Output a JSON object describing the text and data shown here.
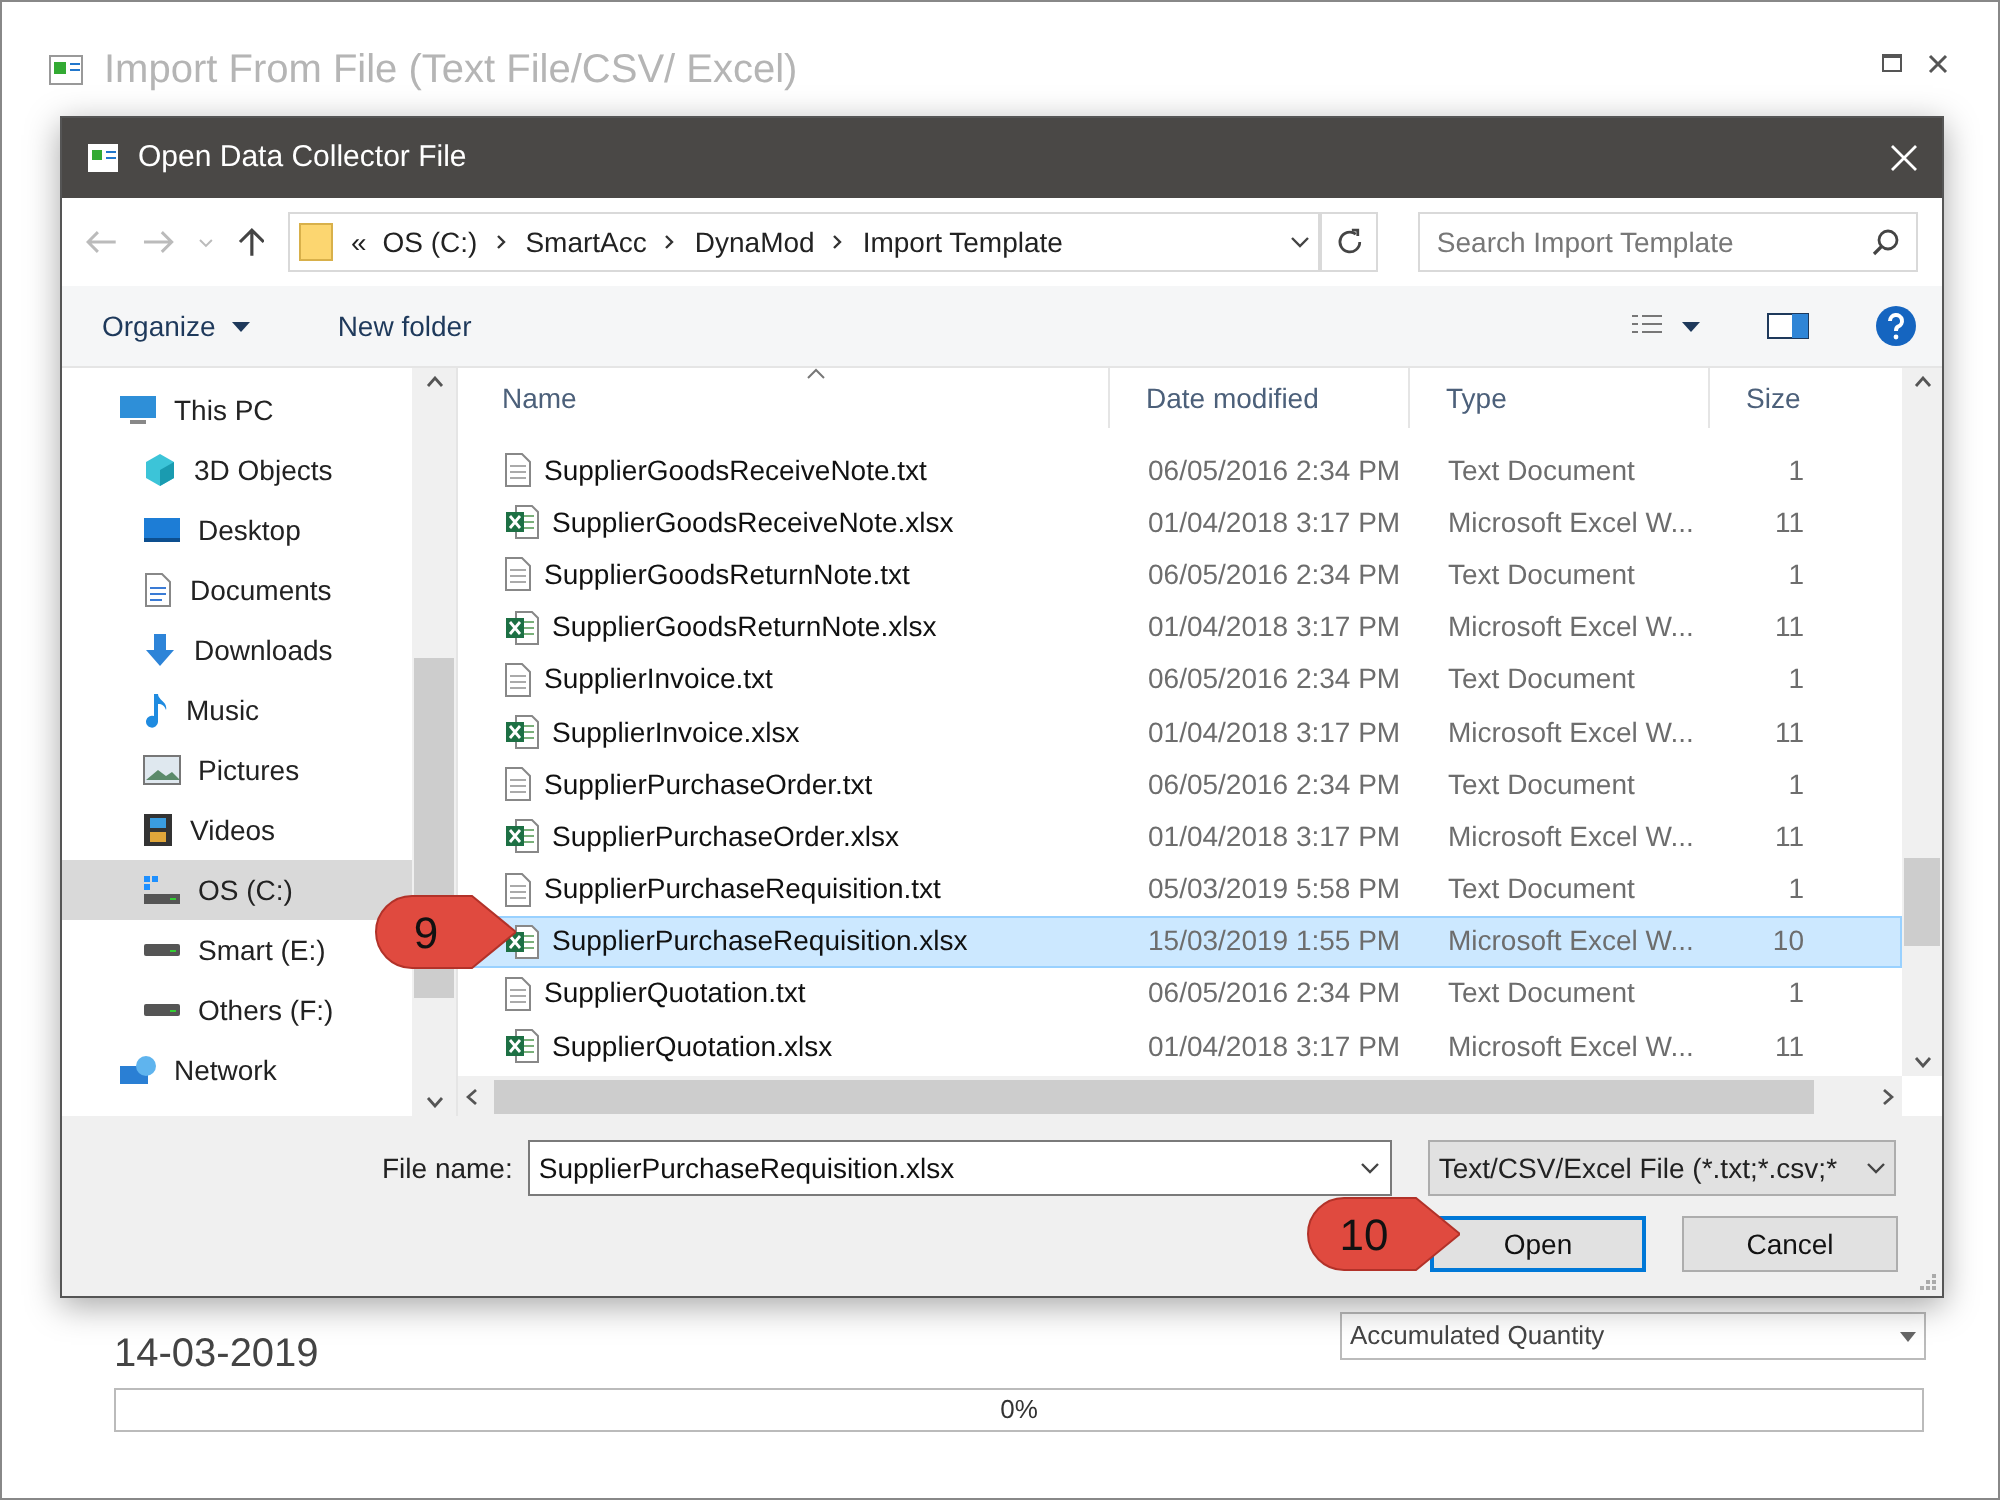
{
  "background_window": {
    "title": "Import From File (Text File/CSV/ Excel)",
    "date": "14-03-2019",
    "mode_dropdown": "Accumulated Quantity",
    "progress": {
      "level": 0,
      "reading": "0%"
    }
  },
  "dialog": {
    "title": "Open Data Collector File",
    "address": {
      "prefix": "«",
      "crumbs": [
        "OS (C:)",
        "SmartAcc",
        "DynaMod",
        "Import Template"
      ]
    },
    "search": {
      "placeholder": "Search Import Template"
    },
    "toolbar": {
      "organize": "Organize",
      "new_folder": "New folder"
    },
    "nav": [
      {
        "label": "This PC",
        "kind": "pc",
        "selected": false,
        "children": [
          {
            "label": "3D Objects",
            "kind": "cube",
            "selected": false
          },
          {
            "label": "Desktop",
            "kind": "desktop",
            "selected": false
          },
          {
            "label": "Documents",
            "kind": "documents",
            "selected": false
          },
          {
            "label": "Downloads",
            "kind": "download",
            "selected": false
          },
          {
            "label": "Music",
            "kind": "music",
            "selected": false
          },
          {
            "label": "Pictures",
            "kind": "pictures",
            "selected": false
          },
          {
            "label": "Videos",
            "kind": "videos",
            "selected": false
          },
          {
            "label": "OS (C:)",
            "kind": "drive-os",
            "selected": true
          },
          {
            "label": "Smart (E:)",
            "kind": "drive",
            "selected": false
          },
          {
            "label": "Others (F:)",
            "kind": "drive",
            "selected": false
          }
        ]
      },
      {
        "label": "Network",
        "kind": "network",
        "selected": false
      }
    ],
    "columns": [
      "Name",
      "Date modified",
      "Type",
      "Size"
    ],
    "files": [
      {
        "kind": "txt",
        "name": "SupplierGoodsReceiveNote.txt",
        "date": "06/05/2016 2:34 PM",
        "type": "Text Document",
        "size": "1",
        "selected": false
      },
      {
        "kind": "xlsx",
        "name": "SupplierGoodsReceiveNote.xlsx",
        "date": "01/04/2018 3:17 PM",
        "type": "Microsoft Excel W...",
        "size": "11",
        "selected": false
      },
      {
        "kind": "txt",
        "name": "SupplierGoodsReturnNote.txt",
        "date": "06/05/2016 2:34 PM",
        "type": "Text Document",
        "size": "1",
        "selected": false
      },
      {
        "kind": "xlsx",
        "name": "SupplierGoodsReturnNote.xlsx",
        "date": "01/04/2018 3:17 PM",
        "type": "Microsoft Excel W...",
        "size": "11",
        "selected": false
      },
      {
        "kind": "txt",
        "name": "SupplierInvoice.txt",
        "date": "06/05/2016 2:34 PM",
        "type": "Text Document",
        "size": "1",
        "selected": false
      },
      {
        "kind": "xlsx",
        "name": "SupplierInvoice.xlsx",
        "date": "01/04/2018 3:17 PM",
        "type": "Microsoft Excel W...",
        "size": "11",
        "selected": false
      },
      {
        "kind": "txt",
        "name": "SupplierPurchaseOrder.txt",
        "date": "06/05/2016 2:34 PM",
        "type": "Text Document",
        "size": "1",
        "selected": false
      },
      {
        "kind": "xlsx",
        "name": "SupplierPurchaseOrder.xlsx",
        "date": "01/04/2018 3:17 PM",
        "type": "Microsoft Excel W...",
        "size": "11",
        "selected": false
      },
      {
        "kind": "txt",
        "name": "SupplierPurchaseRequisition.txt",
        "date": "05/03/2019 5:58 PM",
        "type": "Text Document",
        "size": "1",
        "selected": false
      },
      {
        "kind": "xlsx",
        "name": "SupplierPurchaseRequisition.xlsx",
        "date": "15/03/2019 1:55 PM",
        "type": "Microsoft Excel W...",
        "size": "10",
        "selected": true
      },
      {
        "kind": "txt",
        "name": "SupplierQuotation.txt",
        "date": "06/05/2016 2:34 PM",
        "type": "Text Document",
        "size": "1",
        "selected": false
      },
      {
        "kind": "xlsx",
        "name": "SupplierQuotation.xlsx",
        "date": "01/04/2018 3:17 PM",
        "type": "Microsoft Excel W...",
        "size": "11",
        "selected": false
      }
    ],
    "file_name": {
      "label": "File name:",
      "value": "SupplierPurchaseRequisition.xlsx"
    },
    "file_type": "Text/CSV/Excel File (*.txt;*.csv;*",
    "buttons": [
      {
        "label": "Open",
        "default": true
      },
      {
        "label": "Cancel",
        "default": false
      }
    ]
  },
  "callouts": [
    "9",
    "10"
  ]
}
